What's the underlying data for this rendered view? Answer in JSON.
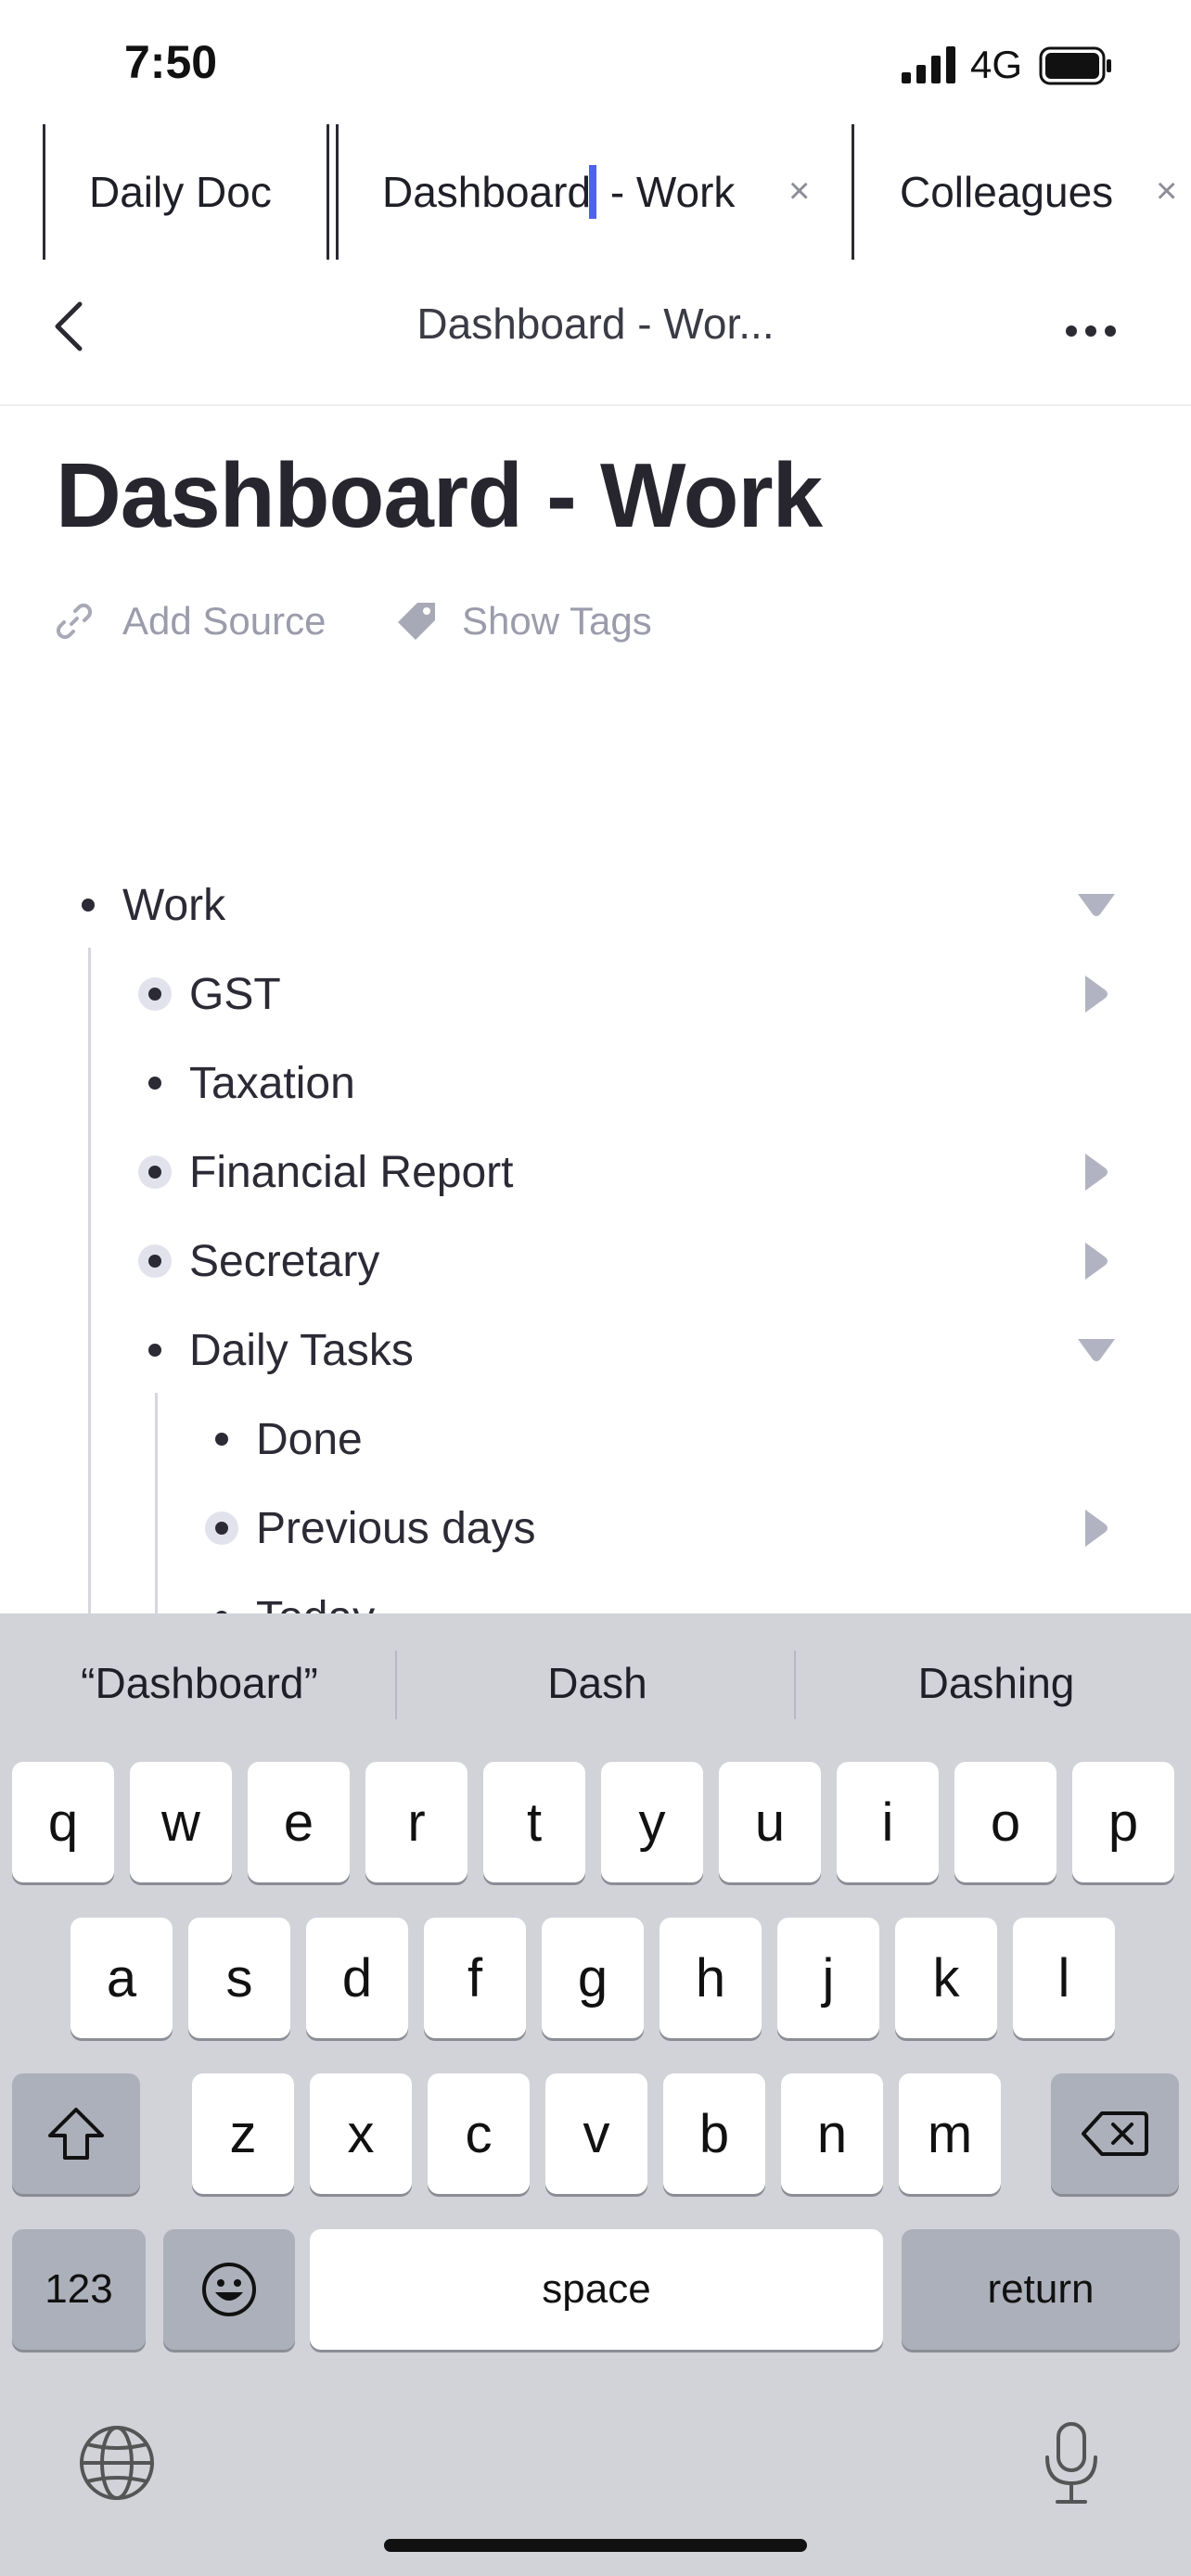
{
  "status": {
    "time": "7:50",
    "network": "4G"
  },
  "tabs": [
    {
      "label": "Daily Doc"
    },
    {
      "label_before_cursor": "Dashboard",
      "label_after_cursor": " - Work",
      "close": "×"
    },
    {
      "label": "Colleagues",
      "close": "×"
    }
  ],
  "nav": {
    "title": "Dashboard - Wor..."
  },
  "page": {
    "title": "Dashboard - Work",
    "add_source": "Add Source",
    "show_tags": "Show Tags"
  },
  "outline": [
    {
      "label": "Work",
      "has_children": true,
      "expanded": true
    },
    {
      "label": "GST",
      "has_children": true,
      "expanded": false
    },
    {
      "label": "Taxation",
      "has_children": false
    },
    {
      "label": "Financial Report",
      "has_children": true,
      "expanded": false
    },
    {
      "label": "Secretary",
      "has_children": true,
      "expanded": false
    },
    {
      "label": "Daily Tasks",
      "has_children": true,
      "expanded": true
    },
    {
      "label": "Done",
      "has_children": false
    },
    {
      "label": "Previous days",
      "has_children": true,
      "expanded": false
    },
    {
      "label": "Today",
      "has_children": true,
      "expanded": true
    }
  ],
  "keyboard": {
    "suggestions": [
      "“Dashboard”",
      "Dash",
      "Dashing"
    ],
    "row1": [
      "q",
      "w",
      "e",
      "r",
      "t",
      "y",
      "u",
      "i",
      "o",
      "p"
    ],
    "row2": [
      "a",
      "s",
      "d",
      "f",
      "g",
      "h",
      "j",
      "k",
      "l"
    ],
    "row3": [
      "z",
      "x",
      "c",
      "v",
      "b",
      "n",
      "m"
    ],
    "numbers_key": "123",
    "space_key": "space",
    "return_key": "return"
  }
}
